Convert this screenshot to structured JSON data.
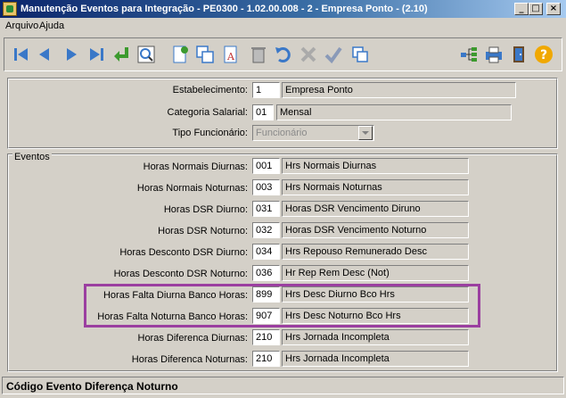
{
  "window": {
    "title": "Manutenção Eventos para Integração - PE0300 - 1.02.00.008 - 2 - Empresa Ponto - (2.10)"
  },
  "menu": {
    "items": [
      "Arquivo",
      "Ajuda"
    ]
  },
  "toolbar": {
    "icons": [
      "first-record-icon",
      "prev-record-icon",
      "next-record-icon",
      "last-record-icon",
      "enter-icon",
      "search-icon",
      "new-icon",
      "copy-icon",
      "edit-icon",
      "delete-icon",
      "undo-icon",
      "cancel-icon",
      "confirm-icon",
      "duplicate-icon",
      "tree-icon",
      "print-icon",
      "exit-door-icon",
      "help-icon"
    ]
  },
  "header_fields": {
    "estabelecimento": {
      "label": "Estabelecimento:",
      "code": "1",
      "desc": "Empresa Ponto"
    },
    "categoria": {
      "label": "Categoria Salarial:",
      "code": "01",
      "desc": "Mensal"
    },
    "tipo": {
      "label": "Tipo Funcionário:",
      "value": "Funcionário"
    }
  },
  "eventos": {
    "legend": "Eventos",
    "rows": [
      {
        "label": "Horas Normais Diurnas:",
        "code": "001",
        "desc": "Hrs Normais Diurnas"
      },
      {
        "label": "Horas Normais Noturnas:",
        "code": "003",
        "desc": "Hrs Normais Noturnas"
      },
      {
        "label": "Horas DSR Diurno:",
        "code": "031",
        "desc": "Horas DSR Vencimento Diruno"
      },
      {
        "label": "Horas DSR Noturno:",
        "code": "032",
        "desc": "Horas DSR Vencimento Noturno"
      },
      {
        "label": "Horas Desconto DSR Diurno:",
        "code": "034",
        "desc": "Hrs Repouso Remunerado Desc"
      },
      {
        "label": "Horas Desconto DSR Noturno:",
        "code": "036",
        "desc": "Hr Rep Rem Desc (Not)"
      },
      {
        "label": "Horas Falta Diurna Banco Horas:",
        "code": "899",
        "desc": "Hrs Desc Diurno Bco Hrs"
      },
      {
        "label": "Horas Falta Noturna Banco Horas:",
        "code": "907",
        "desc": "Hrs Desc Noturno Bco Hrs"
      },
      {
        "label": "Horas Diferenca Diurnas:",
        "code": "210",
        "desc": "Hrs Jornada Incompleta"
      },
      {
        "label": "Horas Diferenca Noturnas:",
        "code": "210",
        "desc": "Hrs Jornada Incompleta"
      }
    ]
  },
  "status": {
    "text": "Código Evento Diferença Noturno"
  },
  "colors": {
    "highlight": "#9b3fa0",
    "titlebar": "#0a246a"
  }
}
